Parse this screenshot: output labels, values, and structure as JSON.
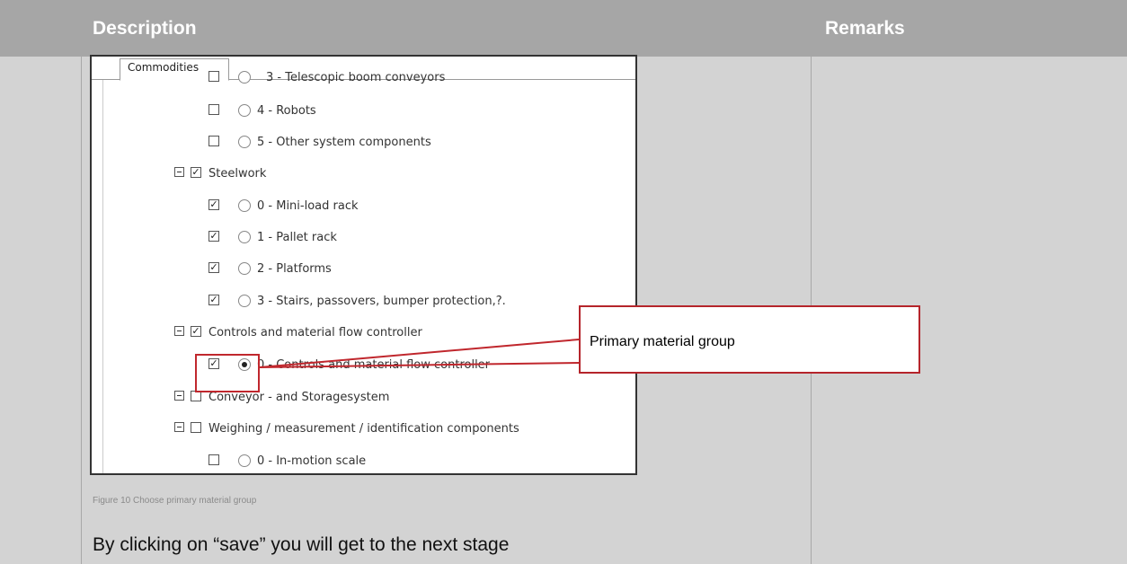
{
  "header": {
    "description": "Description",
    "remarks": "Remarks"
  },
  "screenshot": {
    "tab_label": "Commodities",
    "items": [
      {
        "label": "3 - Telescopic boom conveyors",
        "checked": false,
        "radio": true,
        "selected": false,
        "clipped": true
      },
      {
        "label": "4 - Robots",
        "checked": false,
        "radio": true,
        "selected": false
      },
      {
        "label": "5 - Other system components",
        "checked": false,
        "radio": true,
        "selected": false
      },
      {
        "label": "Steelwork",
        "checked": true,
        "group": true
      },
      {
        "label": "0 - Mini-load rack",
        "checked": true,
        "radio": true,
        "selected": false
      },
      {
        "label": "1 - Pallet rack",
        "checked": true,
        "radio": true,
        "selected": false
      },
      {
        "label": "2 - Platforms",
        "checked": true,
        "radio": true,
        "selected": false
      },
      {
        "label": "3 - Stairs, passovers, bumper protection,?.",
        "checked": true,
        "radio": true,
        "selected": false
      },
      {
        "label": "Controls and material flow controller",
        "checked": true,
        "group": true
      },
      {
        "label": "0 - Controls and material flow controller",
        "checked": true,
        "radio": true,
        "selected": true
      },
      {
        "label": "Conveyor - and Storagesystem",
        "checked": false,
        "group": true
      },
      {
        "label": "Weighing / measurement / identification components",
        "checked": false,
        "group": true
      },
      {
        "label": "0 - In-motion scale",
        "checked": false,
        "radio": true,
        "selected": false
      }
    ]
  },
  "callout": {
    "text": "Primary material group"
  },
  "caption": "Figure 10 Choose primary material group",
  "body_text": "By clicking on “save” you will get to the next stage",
  "colors": {
    "header_bg": "#a6a6a6",
    "cell_bg": "#d3d3d3",
    "callout_border": "#b5252b"
  }
}
